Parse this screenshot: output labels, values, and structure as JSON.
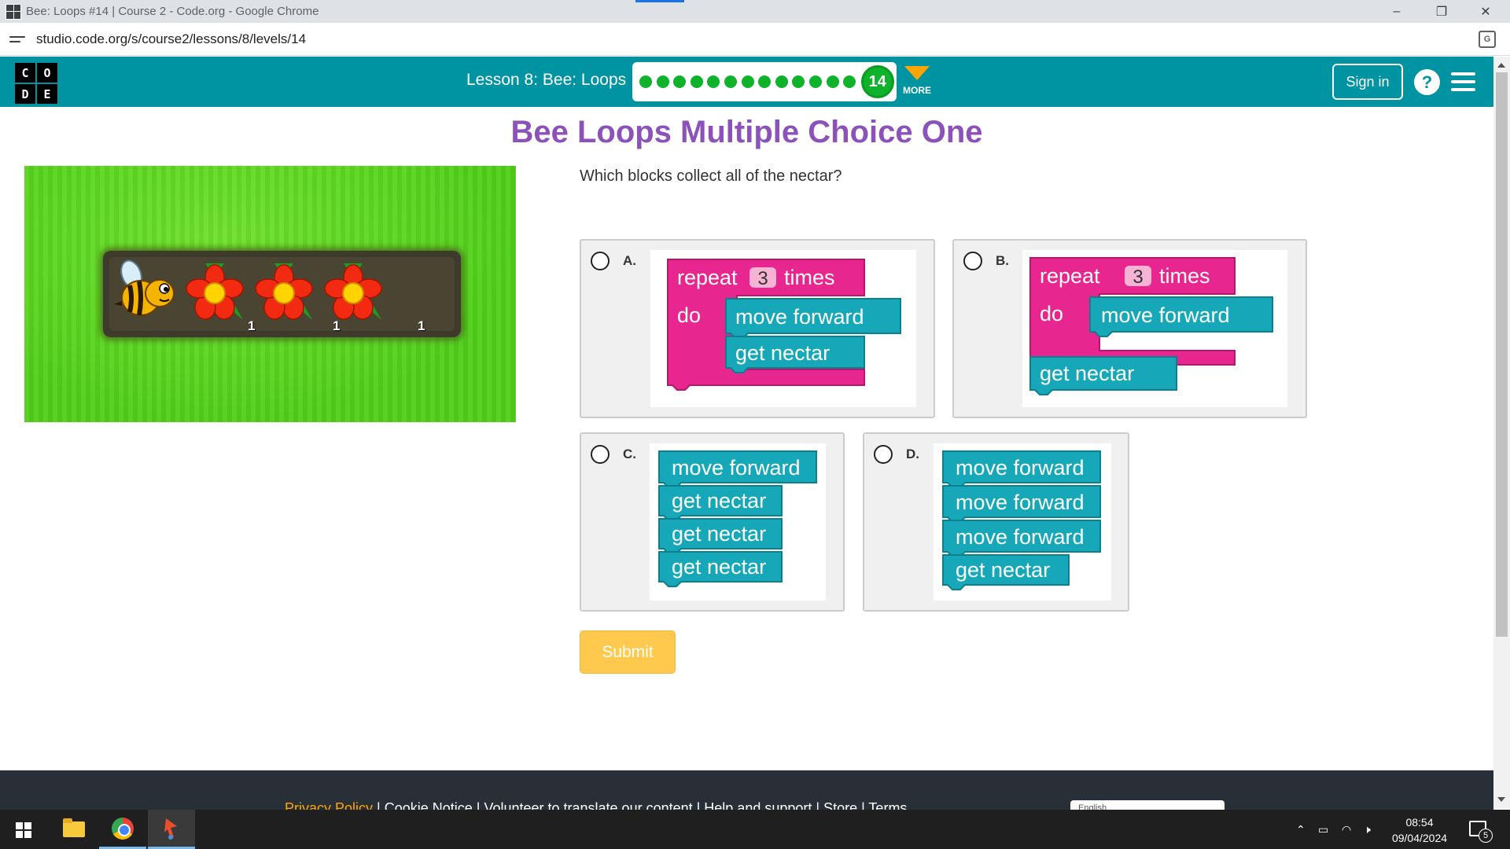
{
  "browser": {
    "tab_title": "Bee: Loops #14 | Course 2 - Code.org - Google Chrome",
    "url": "studio.code.org/s/course2/lessons/8/levels/14",
    "minimize": "–",
    "restore": "❐",
    "close": "✕",
    "translate_icon": "G"
  },
  "header": {
    "logo_letters": [
      "C",
      "O",
      "D",
      "E"
    ],
    "lesson_title": "Lesson 8: Bee: Loops",
    "progress": {
      "completed_dots": 13,
      "current_level": "14"
    },
    "more_label": "MORE",
    "signin_label": "Sign in",
    "help_label": "?"
  },
  "main": {
    "title": "Bee Loops Multiple Choice One",
    "question": "Which blocks collect all of the nectar?",
    "game": {
      "nectar_counts": [
        "1",
        "1",
        "1"
      ]
    },
    "choices": [
      {
        "letter": "A.",
        "repeat_label": "repeat",
        "repeat_count": "3",
        "times_label": "times",
        "do_label": "do",
        "blocks": [
          "move forward",
          "get nectar"
        ]
      },
      {
        "letter": "B.",
        "repeat_label": "repeat",
        "repeat_count": "3",
        "times_label": "times",
        "do_label": "do",
        "blocks": [
          "move forward",
          "get nectar"
        ]
      },
      {
        "letter": "C.",
        "blocks": [
          "move forward",
          "get nectar",
          "get nectar",
          "get nectar"
        ]
      },
      {
        "letter": "D.",
        "blocks": [
          "move forward",
          "move forward",
          "move forward",
          "get nectar"
        ]
      }
    ],
    "submit_label": "Submit"
  },
  "footer": {
    "privacy": "Privacy Policy",
    "links_rest": " | Cookie Notice | Volunteer to translate our content | Help and support | Store | Terms",
    "language": "English"
  },
  "taskbar": {
    "time": "08:54",
    "date": "09/04/2024",
    "notification_count": "5"
  },
  "colors": {
    "header_bg": "#0094a3",
    "title_purple": "#8c52ba",
    "loop_block": "#e7268f",
    "action_block": "#16a8b9",
    "progress_green": "#0eb22b",
    "submit_yellow": "#ffc94d"
  }
}
